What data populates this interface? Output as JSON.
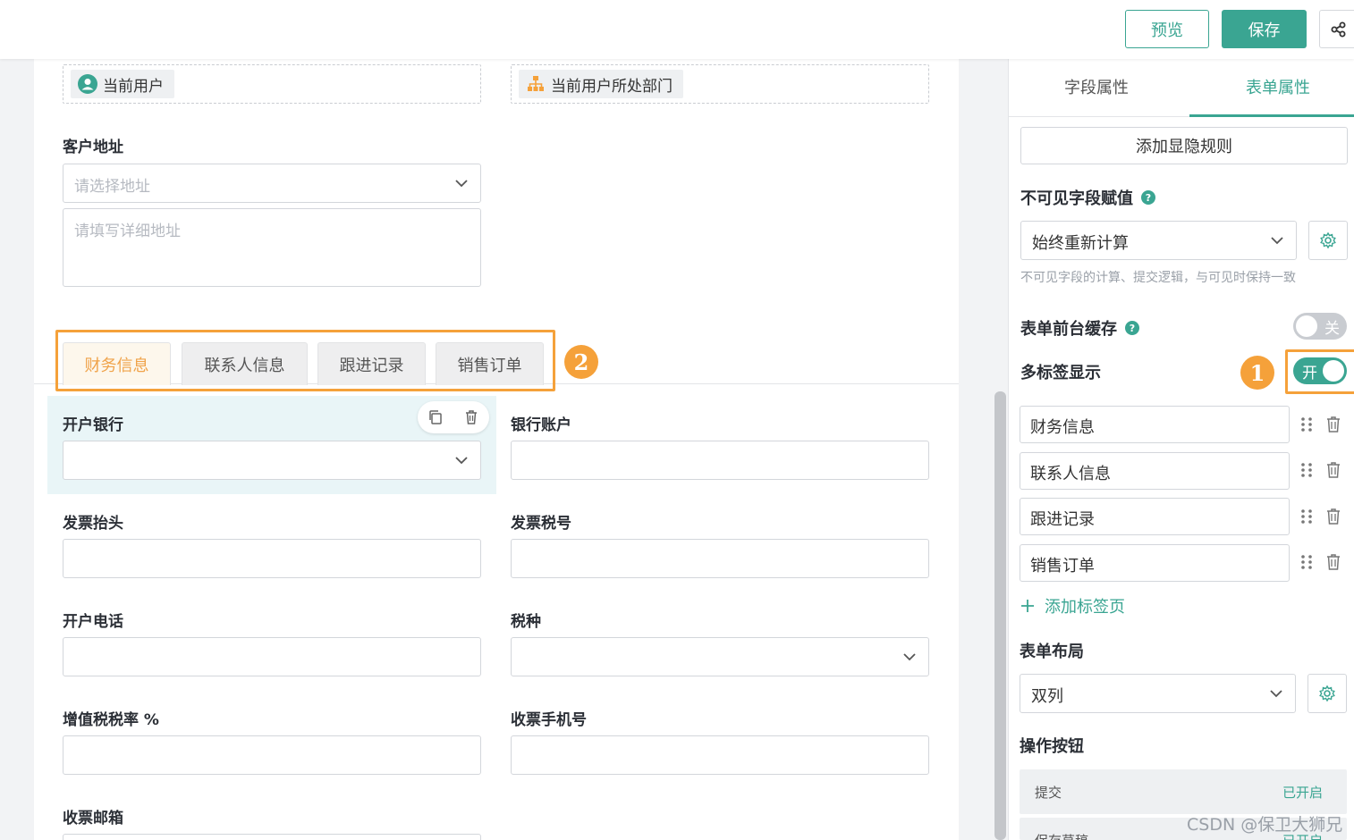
{
  "topbar": {
    "preview_label": "预览",
    "save_label": "保存",
    "share_icon": "share-icon"
  },
  "canvas": {
    "current_user_chip": "当前用户",
    "current_dept_chip": "当前用户所处部门",
    "address": {
      "label": "客户地址",
      "select_placeholder": "请选择地址",
      "detail_placeholder": "请填写详细地址"
    },
    "tabs": [
      {
        "label": "财务信息",
        "active": true
      },
      {
        "label": "联系人信息",
        "active": false
      },
      {
        "label": "跟进记录",
        "active": false
      },
      {
        "label": "销售订单",
        "active": false
      }
    ],
    "badge_2": "2",
    "fields": {
      "bank_label": "开户银行",
      "account_label": "银行账户",
      "invoice_title_label": "发票抬头",
      "tax_no_label": "发票税号",
      "phone_label": "开户电话",
      "tax_type_label": "税种",
      "vat_rate_label": "增值税税率 %",
      "mobile_label": "收票手机号",
      "email_label": "收票邮箱"
    }
  },
  "panel": {
    "tabs": [
      {
        "label": "字段属性",
        "active": false
      },
      {
        "label": "表单属性",
        "active": true
      }
    ],
    "add_rule_button": "添加显隐规则",
    "invisible_assign": {
      "label": "不可见字段赋值",
      "value": "始终重新计算",
      "hint": "不可见字段的计算、提交逻辑，与可见时保持一致"
    },
    "cache": {
      "label": "表单前台缓存",
      "toggle_text": "关",
      "on": false
    },
    "multi_tab": {
      "label": "多标签显示",
      "toggle_text": "开",
      "on": true,
      "badge": "1"
    },
    "tab_items": [
      "财务信息",
      "联系人信息",
      "跟进记录",
      "销售订单"
    ],
    "add_tab_label": "添加标签页",
    "layout": {
      "label": "表单布局",
      "value": "双列"
    },
    "actions": {
      "label": "操作按钮",
      "rows": [
        {
          "name": "提交",
          "status": "已开启"
        },
        {
          "name": "保存草稿",
          "status": "已开启"
        }
      ]
    }
  },
  "watermark": "CSDN @保卫大狮兄",
  "colors": {
    "accent": "#3aa592",
    "highlight": "#f5a13a",
    "selected_bg": "#e9f5f7"
  }
}
